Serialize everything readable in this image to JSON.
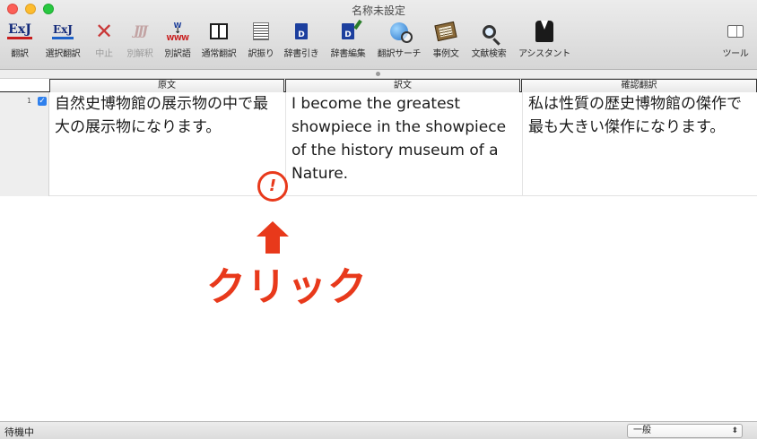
{
  "window": {
    "title": "名称未設定"
  },
  "toolbar": {
    "items": [
      {
        "label": "翻訳",
        "icon": "translate-exj-icon"
      },
      {
        "label": "選択翻訳",
        "icon": "selected-translate-icon"
      },
      {
        "label": "中止",
        "icon": "stop-x-icon"
      },
      {
        "label": "別解釈",
        "icon": "alternate-interpretation-icon"
      },
      {
        "label": "別訳語",
        "icon": "alternate-word-icon"
      },
      {
        "label": "通常翻訳",
        "icon": "normal-translate-book-icon"
      },
      {
        "label": "訳振り",
        "icon": "interlinear-lines-icon"
      },
      {
        "label": "辞書引き",
        "icon": "dictionary-icon"
      },
      {
        "label": "辞書編集",
        "icon": "dictionary-edit-icon"
      },
      {
        "label": "翻訳サーチ",
        "icon": "translate-search-globe-icon"
      },
      {
        "label": "事例文",
        "icon": "example-notebook-icon"
      },
      {
        "label": "文献検索",
        "icon": "literature-search-magnifier-icon"
      },
      {
        "label": "アシスタント",
        "icon": "assistant-suit-icon"
      },
      {
        "label": "ツール",
        "icon": "tools-sidebar-icon"
      }
    ],
    "exj_text": "ExJ",
    "jjj_text": "JJJ",
    "www_top": "W",
    "www_bottom": "WWW",
    "dict_letter": "D"
  },
  "grid": {
    "headers": {
      "source": "原文",
      "translation": "訳文",
      "check": "確認翻訳"
    },
    "rows": [
      {
        "number": "1",
        "checked": true,
        "source": "自然史博物館の展示物の中で最大の展示物になります。",
        "translation": "I become the greatest showpiece in the showpiece of the history museum of a Nature.",
        "check": "私は性質の歴史博物館の傑作で最も大きい傑作になります。"
      }
    ]
  },
  "annotation": {
    "alert_symbol": "!",
    "click_label": "クリック",
    "color": "#e8391b"
  },
  "statusbar": {
    "status": "待機中",
    "mode": "一般"
  }
}
